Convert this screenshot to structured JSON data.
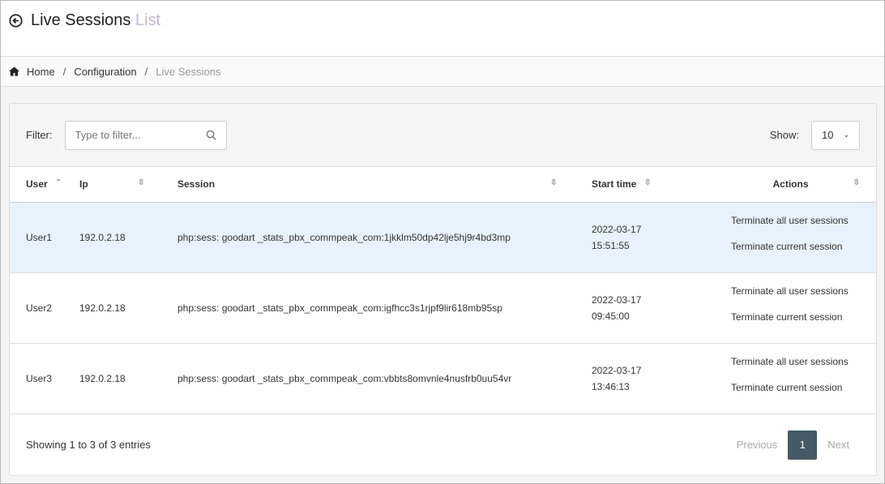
{
  "header": {
    "title": "Live Sessions",
    "subtitle": "List"
  },
  "breadcrumb": [
    "Home",
    "Configuration",
    "Live Sessions"
  ],
  "filter": {
    "label": "Filter:",
    "placeholder": "Type to filter...",
    "value": ""
  },
  "show": {
    "label": "Show:",
    "value": "10"
  },
  "columns": [
    "User",
    "Ip",
    "Session",
    "Start time",
    "Actions"
  ],
  "rows": [
    {
      "user": "User1",
      "ip": "192.0.2.18",
      "session": "php:sess: goodart _stats_pbx_commpeak_com:1jkklm50dp42lje5hj9r4bd3mp",
      "date": "2022-03-17",
      "time": "15:51:55",
      "a1": "Terminate all user sessions",
      "a2": "Terminate current session"
    },
    {
      "user": "User2",
      "ip": "192.0.2.18",
      "session": "php:sess: goodart _stats_pbx_commpeak_com:igfhcc3s1rjpf9lir618mb95sp",
      "date": "2022-03-17",
      "time": "09:45:00",
      "a1": "Terminate all user sessions",
      "a2": "Terminate current session"
    },
    {
      "user": "User3",
      "ip": "192.0.2.18",
      "session": "php:sess: goodart _stats_pbx_commpeak_com:vbbts8omvnle4nusfrb0uu54vr",
      "date": "2022-03-17",
      "time": "13:46:13",
      "a1": "Terminate all user sessions",
      "a2": "Terminate current session"
    }
  ],
  "footer": {
    "info": "Showing 1 to 3 of 3 entries",
    "previous": "Previous",
    "page": "1",
    "next": "Next"
  },
  "colors": {
    "highlight_row": "#e8f2fc",
    "active_page": "#455a64"
  }
}
